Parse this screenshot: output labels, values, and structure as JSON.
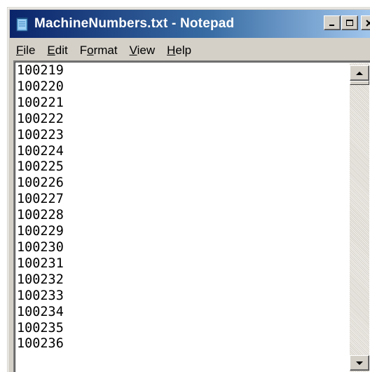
{
  "window": {
    "title": "MachineNumbers.txt - Notepad",
    "title_gradient": [
      "#0a246a",
      "#3a6ea5",
      "#a6caf0"
    ],
    "chrome_color": "#d4d0c8"
  },
  "title_buttons": {
    "minimize_icon": "minimize-icon",
    "maximize_icon": "maximize-icon",
    "close_icon": "close-icon"
  },
  "menu": {
    "items": [
      {
        "mnemonic": "F",
        "rest": "ile"
      },
      {
        "mnemonic": "E",
        "rest": "dit"
      },
      {
        "prefix": "F",
        "mnemonic": "o",
        "rest": "rmat"
      },
      {
        "mnemonic": "V",
        "rest": "iew"
      },
      {
        "mnemonic": "H",
        "rest": "elp"
      }
    ]
  },
  "document": {
    "lines": [
      "100219",
      "100220",
      "100221",
      "100222",
      "100223",
      "100224",
      "100225",
      "100226",
      "100227",
      "100228",
      "100229",
      "100230",
      "100231",
      "100232",
      "100233",
      "100234",
      "100235",
      "100236"
    ]
  },
  "scrollbar": {
    "up_icon": "scroll-up-arrow-icon",
    "down_icon": "scroll-down-arrow-icon",
    "position": 0
  }
}
